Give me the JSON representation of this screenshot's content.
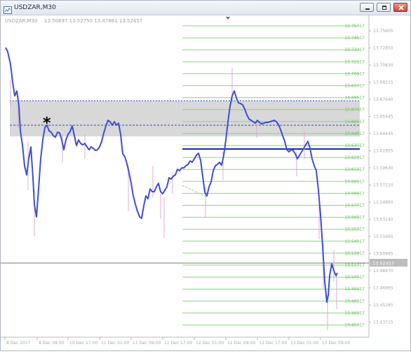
{
  "window": {
    "title": "USDZAR,M30"
  },
  "chart_header": {
    "symbol_text": "USDZAR,M30",
    "ohlc_text": "13.50697 13.52750 13.47861 13.52457"
  },
  "price_axis": {
    "labels": [
      "13.75605",
      "13.72850",
      "13.70830",
      "13.68215",
      "13.67640",
      "13.65945",
      "13.64445",
      "13.61955",
      "13.59630",
      "13.57210",
      "13.54860",
      "13.53240",
      "13.51665",
      "13.50945",
      "13.48470",
      "13.46965",
      "13.45265",
      "13.43715"
    ],
    "current_price": "13.52457"
  },
  "fib_levels": {
    "labels": [
      "13.75717",
      "13.74517",
      "13.73317",
      "13.72117",
      "13.70917",
      "13.69717",
      "13.68517",
      "13.67317",
      "13.66117",
      "13.64917",
      "13.63717",
      "13.62917",
      "13.61317",
      "13.60117",
      "13.58917",
      "13.57717",
      "13.56517",
      "13.55317",
      "13.54117",
      "13.52917",
      "13.51717",
      "13.50517",
      "13.49317",
      "13.48117",
      "13.46917",
      "13.45717"
    ]
  },
  "time_axis": {
    "labels": [
      "8 Dec 2017",
      "8 Dec 09:00",
      "10 Dec 17:00",
      "11 Dec 01:00",
      "11 Dec 09:00",
      "11 Dec 17:00",
      "12 Dec 01:00",
      "12 Dec 09:00",
      "12 Dec 17:00",
      "13 Dec 01:00",
      "13 Dec 09:00"
    ]
  },
  "annotation": {
    "marker": "*"
  },
  "colors": {
    "price_line": "#3b4fd6",
    "fib_line": "#86d77a",
    "zone_fill": "#d8d8d8",
    "dotted_line": "#3344cc",
    "solid_level": "#1c2aa8",
    "candle_wick": "#e0a8d6"
  },
  "chart_data": {
    "type": "line",
    "x": [
      "8 Dec 2017",
      "8 Dec 09:00",
      "10 Dec 17:00",
      "11 Dec 01:00",
      "11 Dec 09:00",
      "11 Dec 17:00",
      "12 Dec 01:00",
      "12 Dec 09:00",
      "12 Dec 17:00",
      "13 Dec 01:00",
      "13 Dec 09:00"
    ],
    "values": [
      13.73,
      13.52,
      13.6,
      13.63,
      13.56,
      13.62,
      13.65,
      13.66,
      13.63,
      13.6,
      13.5
    ],
    "y_range": [
      13.44,
      13.76
    ],
    "fib_levels": [
      13.75717,
      13.74517,
      13.73317,
      13.72117,
      13.70917,
      13.69717,
      13.68517,
      13.67317,
      13.66117,
      13.64917,
      13.63717,
      13.62917,
      13.61317,
      13.60117,
      13.58917,
      13.57717,
      13.56517,
      13.55317,
      13.54117,
      13.52917,
      13.51717,
      13.50517,
      13.49317,
      13.48117,
      13.46917,
      13.45717
    ]
  }
}
